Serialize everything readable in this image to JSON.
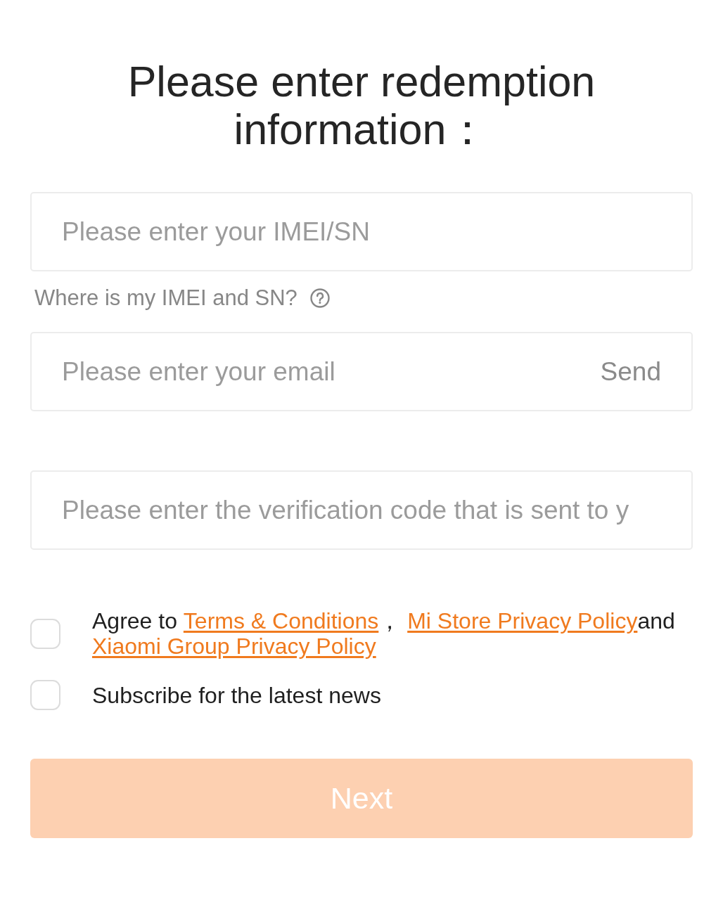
{
  "title": "Please enter redemption information：",
  "imei_field": {
    "placeholder": "Please enter your IMEI/SN"
  },
  "help": {
    "text": "Where is my IMEI and SN?"
  },
  "email_field": {
    "placeholder": "Please enter your email",
    "send_button": "Send"
  },
  "code_field": {
    "placeholder": "Please enter the verification code that is sent to y"
  },
  "agreement": {
    "checked": false,
    "parts": [
      {
        "kind": "text",
        "text": "Agree to "
      },
      {
        "kind": "link",
        "text": "Terms & Conditions"
      },
      {
        "kind": "text",
        "text": "， "
      },
      {
        "kind": "link",
        "text": "Mi Store Privacy Policy"
      },
      {
        "kind": "text",
        "text": "and"
      },
      {
        "kind": "link",
        "text": "Xiaomi Group Privacy Policy"
      }
    ]
  },
  "subscribe": {
    "checked": false,
    "label": "Subscribe for the latest news"
  },
  "next_button": {
    "label": "Next",
    "disabled": true
  }
}
